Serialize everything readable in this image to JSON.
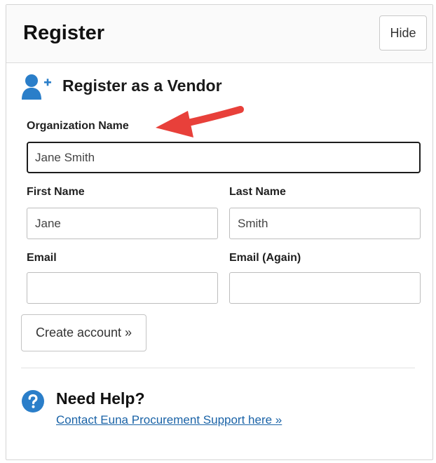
{
  "header": {
    "title": "Register",
    "hide_label": "Hide"
  },
  "vendor_section": {
    "title": "Register as a Vendor",
    "icon": "user-plus-icon"
  },
  "form": {
    "organization_name": {
      "label": "Organization Name",
      "value": "Jane Smith"
    },
    "first_name": {
      "label": "First Name",
      "value": "Jane"
    },
    "last_name": {
      "label": "Last Name",
      "value": "Smith"
    },
    "email": {
      "label": "Email",
      "value": ""
    },
    "email_again": {
      "label": "Email (Again)",
      "value": ""
    },
    "create_account_label": "Create account »"
  },
  "help": {
    "title": "Need Help?",
    "link_text": "Contact Euna Procurement Support here »",
    "icon": "question-circle-icon"
  },
  "annotation": {
    "arrow_color": "#e8403a",
    "points_to": "Organization Name"
  },
  "colors": {
    "accent": "#2a7ec9",
    "link": "#1a63a7"
  }
}
